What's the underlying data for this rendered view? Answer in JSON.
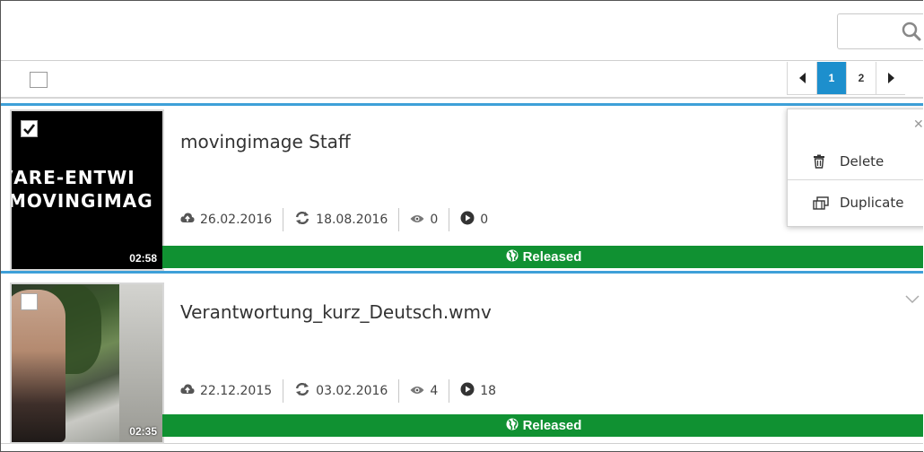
{
  "search": {
    "icon": "search-icon"
  },
  "toolbar": {
    "select_all_icon": "checkbox-icon"
  },
  "pagination": {
    "prev_icon": "caret-left-icon",
    "pages": [
      "1",
      "2"
    ],
    "active_page": "1",
    "next_icon": "caret-right-icon"
  },
  "videos": [
    {
      "title": "movingimage Staff",
      "thumbnail_text": [
        "/ARE-ENTWI",
        "MOVINGIMAG"
      ],
      "duration": "02:58",
      "checked": true,
      "uploaded": "26.02.2016",
      "updated": "18.08.2016",
      "views": "0",
      "plays": "0",
      "status": "Released"
    },
    {
      "title": "Verantwortung_kurz_Deutsch.wmv",
      "duration": "02:35",
      "checked": false,
      "uploaded": "22.12.2015",
      "updated": "03.02.2016",
      "views": "4",
      "plays": "18",
      "status": "Released"
    }
  ],
  "context_menu": {
    "close_icon": "close-icon",
    "items": [
      {
        "label": "Delete",
        "icon": "trash-icon"
      },
      {
        "label": "Duplicate",
        "icon": "duplicate-icon"
      }
    ]
  },
  "colors": {
    "status_green": "#109132",
    "accent_blue": "#1d8fcd",
    "selected_border": "#3ea0d8"
  }
}
